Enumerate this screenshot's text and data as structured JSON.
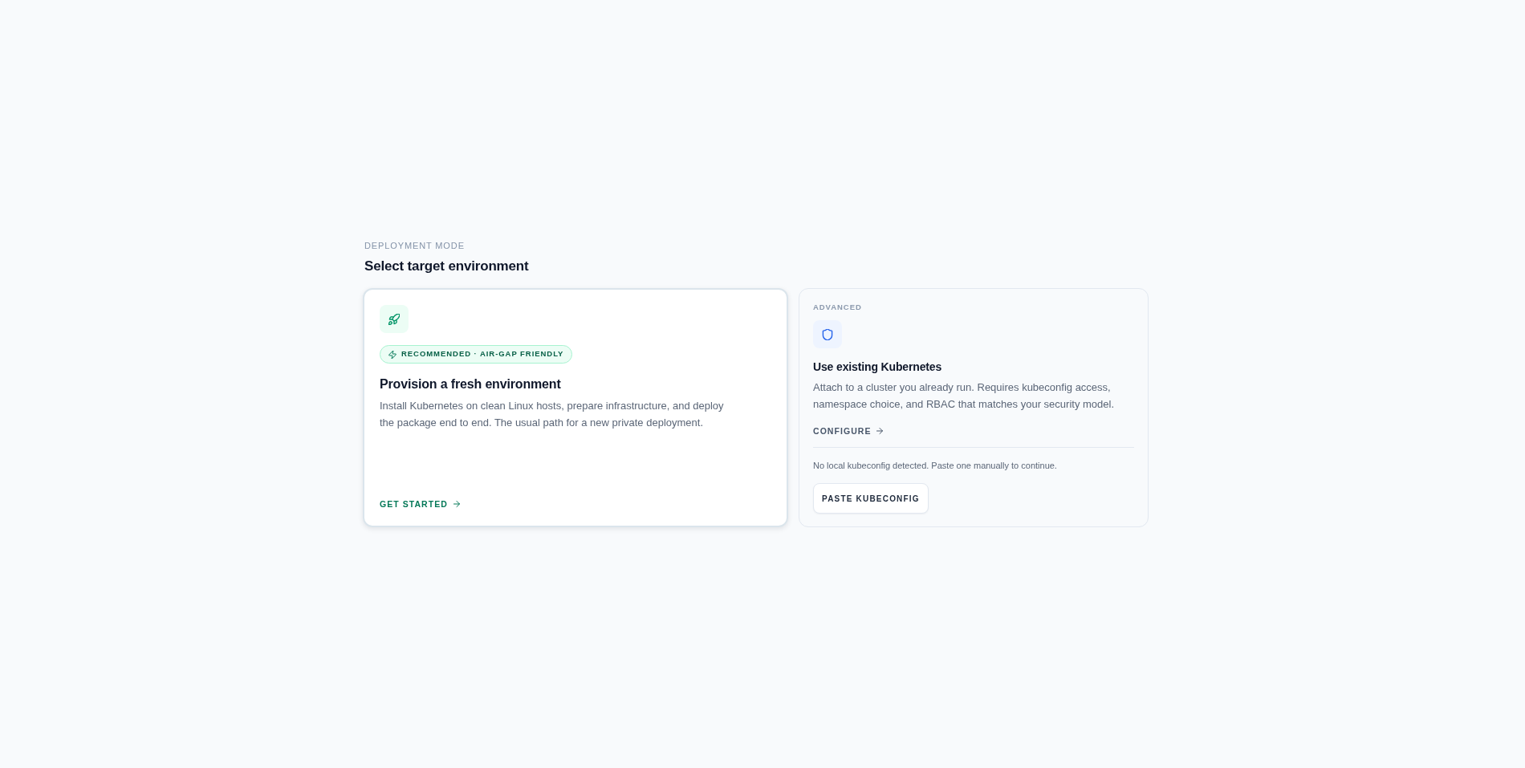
{
  "header": {
    "eyebrow": "DEPLOYMENT MODE",
    "title": "Select target environment"
  },
  "options": [
    {
      "kind": "provision",
      "selected": true,
      "badge": "RECOMMENDED · AIR-GAP FRIENDLY",
      "title": "Provision a fresh environment",
      "description": "Install Kubernetes on clean Linux hosts, prepare infrastructure, and deploy the package end to end. The usual path for a new private deployment.",
      "action": "GET STARTED"
    },
    {
      "kind": "existing",
      "selected": false,
      "eyebrow": "ADVANCED",
      "title": "Use existing Kubernetes",
      "description": "Attach to a cluster you already run. Requires kubeconfig access, namespace choice, and RBAC that matches your security model.",
      "action": "CONFIGURE",
      "notice": "No local kubeconfig detected. Paste one manually to continue.",
      "button": "PASTE KUBECONFIG"
    }
  ]
}
